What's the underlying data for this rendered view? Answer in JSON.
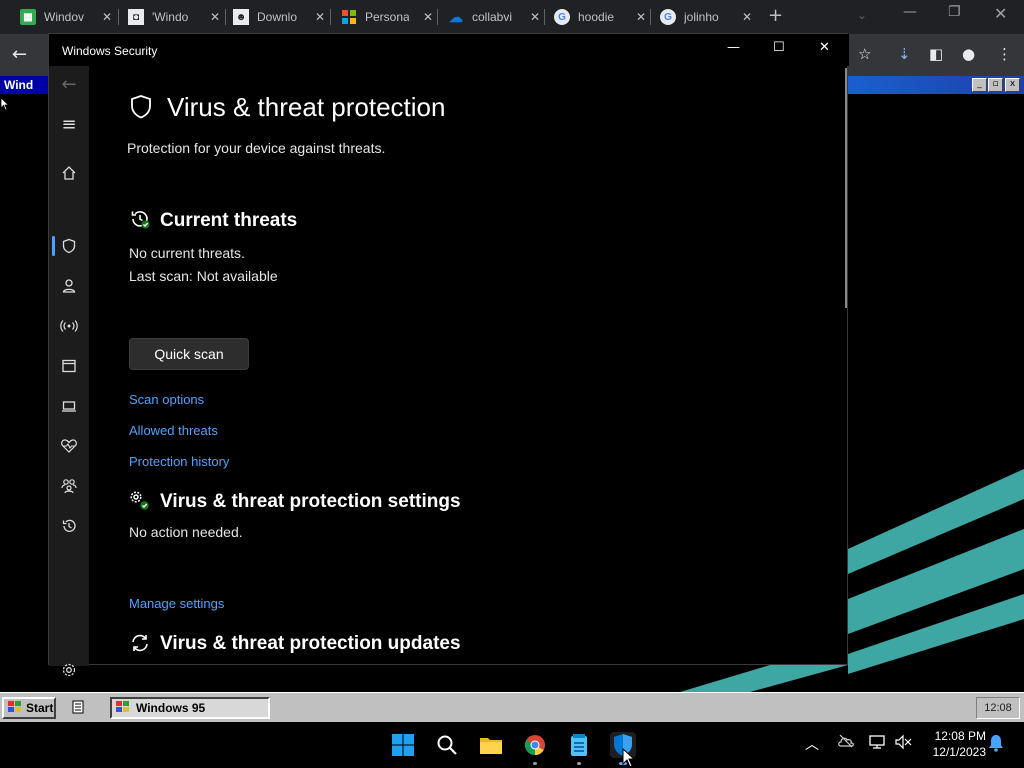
{
  "browser": {
    "tabs": [
      {
        "title": "Windov",
        "favicon": "sheet-icon",
        "color": "#34a853"
      },
      {
        "title": "'Windo",
        "favicon": "page-icon",
        "color": "#e8eaed"
      },
      {
        "title": "Downlo",
        "favicon": "avatar-icon",
        "color": "#e8eaed"
      },
      {
        "title": "Persona",
        "favicon": "microsoft-icon",
        "color": "#f25022"
      },
      {
        "title": "collabvi",
        "favicon": "cloud-icon",
        "color": "#0f78d4"
      },
      {
        "title": "hoodie",
        "favicon": "google-icon",
        "color": "#e8eaed"
      },
      {
        "title": "jolinho",
        "favicon": "google-icon",
        "color": "#e8eaed"
      }
    ],
    "new_tab": "+"
  },
  "vm": {
    "title_bar_text": "Wind",
    "taskbar": {
      "start_label": "Start",
      "app_label": "Windows 95",
      "clock": "12:08"
    }
  },
  "security_window": {
    "title": "Windows Security",
    "page_title": "Virus & threat protection",
    "subtitle": "Protection for your device against threats.",
    "current_threats": {
      "heading": "Current threats",
      "status": "No current threats.",
      "last_scan": "Last scan: Not available",
      "quick_scan": "Quick scan",
      "links": [
        "Scan options",
        "Allowed threats",
        "Protection history"
      ]
    },
    "settings": {
      "heading": "Virus & threat protection settings",
      "status": "No action needed.",
      "link": "Manage settings"
    },
    "updates": {
      "heading": "Virus & threat protection updates"
    },
    "nav": [
      "home-icon",
      "shield-icon",
      "account-icon",
      "firewall-icon",
      "app-browser-icon",
      "device-security-icon",
      "health-icon",
      "family-icon",
      "history-icon",
      "settings-icon"
    ],
    "accent": "#4aa3ff"
  },
  "system_tray": {
    "time": "12:08 PM",
    "date": "12/1/2023"
  }
}
